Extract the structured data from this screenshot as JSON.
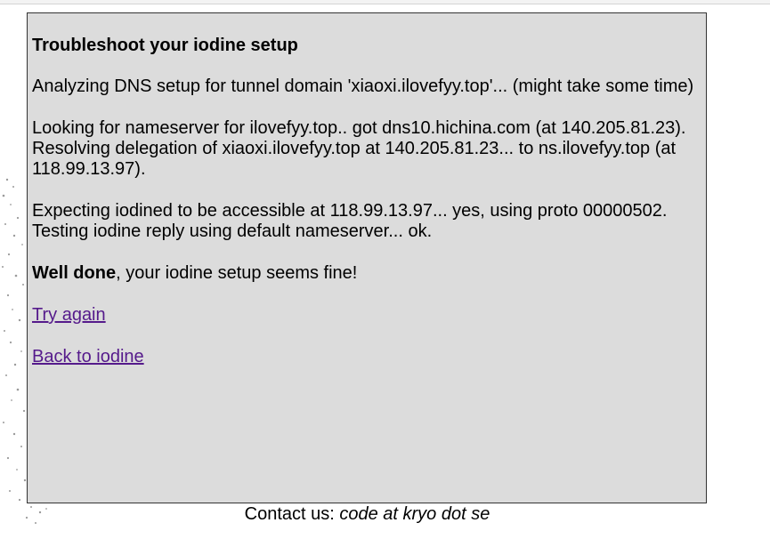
{
  "page": {
    "title": "Troubleshoot your iodine setup",
    "analyzing": "Analyzing DNS setup for tunnel domain 'xiaoxi.ilovefyy.top'... (might take some time)",
    "ns_lookup": "Looking for nameserver for ilovefyy.top.. got dns10.hichina.com (at 140.205.81.23).",
    "delegation": "Resolving delegation of xiaoxi.ilovefyy.top at 140.205.81.23... to ns.ilovefyy.top (at 118.99.13.97).",
    "expecting": "Expecting iodined to be accessible at 118.99.13.97... yes, using proto 00000502.",
    "testing": "Testing iodine reply using default nameserver... ok.",
    "result_strong": "Well done",
    "result_rest": ", your iodine setup seems fine!",
    "try_again_link": "Try again",
    "back_link": "Back to iodine"
  },
  "footer": {
    "prefix": "Contact us: ",
    "email": "code at kryo dot se"
  },
  "colors": {
    "panel_bg": "#dcdcdc",
    "link_visited": "#551a8b"
  }
}
